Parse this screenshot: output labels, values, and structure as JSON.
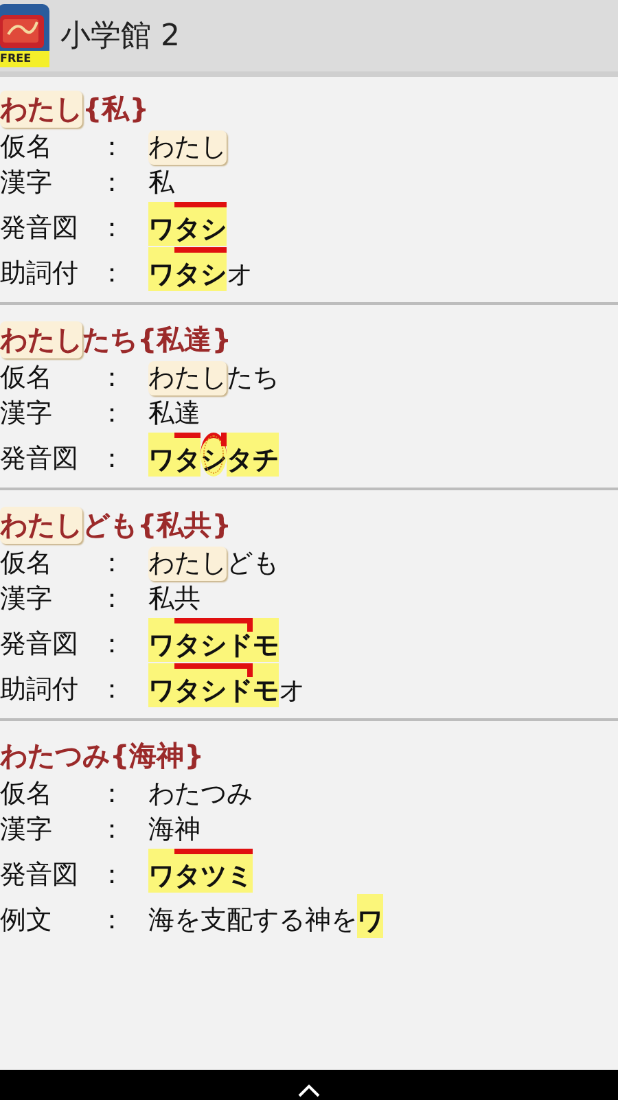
{
  "app_bar": {
    "icon_badge": "FREE",
    "title": "小学館 2"
  },
  "entries": [
    {
      "heading": [
        {
          "text": "わたし",
          "highlight": true
        },
        {
          "text": "{私}",
          "highlight": false
        }
      ],
      "rows": [
        {
          "kind": "text",
          "label": "仮名",
          "colon": "：",
          "parts": [
            {
              "text": "わたし",
              "highlight": true
            }
          ]
        },
        {
          "kind": "text",
          "label": "漢字",
          "colon": "：",
          "parts": [
            {
              "text": "私",
              "highlight": false
            }
          ]
        },
        {
          "kind": "pitch",
          "label": "発音図",
          "colon": "：",
          "segments": [
            {
              "text": "ワ",
              "high": false
            },
            {
              "text": "タシ",
              "high": true,
              "drop": false
            }
          ]
        },
        {
          "kind": "pitch",
          "label": "助詞付",
          "colon": "：",
          "segments": [
            {
              "text": "ワ",
              "high": false
            },
            {
              "text": "タシ",
              "high": true,
              "drop": false
            }
          ],
          "suffix": "オ"
        }
      ]
    },
    {
      "heading": [
        {
          "text": "わたし",
          "highlight": true
        },
        {
          "text": "たち{私達}",
          "highlight": false
        }
      ],
      "rows": [
        {
          "kind": "text",
          "label": "仮名",
          "colon": "：",
          "parts": [
            {
              "text": "わたし",
              "highlight": true
            },
            {
              "text": "たち",
              "highlight": false
            }
          ]
        },
        {
          "kind": "text",
          "label": "漢字",
          "colon": "：",
          "parts": [
            {
              "text": "私達",
              "highlight": false
            }
          ]
        },
        {
          "kind": "pitch",
          "label": "発音図",
          "colon": "：",
          "segments": [
            {
              "text": "ワ",
              "high": false
            },
            {
              "text": "タ",
              "high": true,
              "drop": false
            },
            {
              "text": "シ",
              "high": true,
              "drop": true,
              "devoiced": true
            },
            {
              "text": "タチ",
              "high": false
            }
          ]
        }
      ]
    },
    {
      "heading": [
        {
          "text": "わたし",
          "highlight": true
        },
        {
          "text": "ども{私共}",
          "highlight": false
        }
      ],
      "rows": [
        {
          "kind": "text",
          "label": "仮名",
          "colon": "：",
          "parts": [
            {
              "text": "わたし",
              "highlight": true
            },
            {
              "text": "ども",
              "highlight": false
            }
          ]
        },
        {
          "kind": "text",
          "label": "漢字",
          "colon": "：",
          "parts": [
            {
              "text": "私共",
              "highlight": false
            }
          ]
        },
        {
          "kind": "pitch",
          "label": "発音図",
          "colon": "：",
          "segments": [
            {
              "text": "ワ",
              "high": false
            },
            {
              "text": "タシド",
              "high": true,
              "drop": true
            },
            {
              "text": "モ",
              "high": false
            }
          ]
        },
        {
          "kind": "pitch",
          "label": "助詞付",
          "colon": "：",
          "segments": [
            {
              "text": "ワ",
              "high": false
            },
            {
              "text": "タシド",
              "high": true,
              "drop": true
            },
            {
              "text": "モ",
              "high": false
            }
          ],
          "suffix": "オ"
        }
      ]
    },
    {
      "heading": [
        {
          "text": "わたつみ{海神}",
          "highlight": false
        }
      ],
      "rows": [
        {
          "kind": "text",
          "label": "仮名",
          "colon": "：",
          "parts": [
            {
              "text": "わたつみ",
              "highlight": false
            }
          ]
        },
        {
          "kind": "text",
          "label": "漢字",
          "colon": "：",
          "parts": [
            {
              "text": "海神",
              "highlight": false
            }
          ]
        },
        {
          "kind": "pitch",
          "label": "発音図",
          "colon": "：",
          "segments": [
            {
              "text": "ワ",
              "high": false
            },
            {
              "text": "タツミ",
              "high": true,
              "drop": false
            }
          ]
        },
        {
          "kind": "example",
          "label": "例文",
          "colon": "：",
          "prefix": "海を支配する神を",
          "segments": [
            {
              "text": "ワ",
              "high": false
            }
          ]
        }
      ]
    }
  ]
}
